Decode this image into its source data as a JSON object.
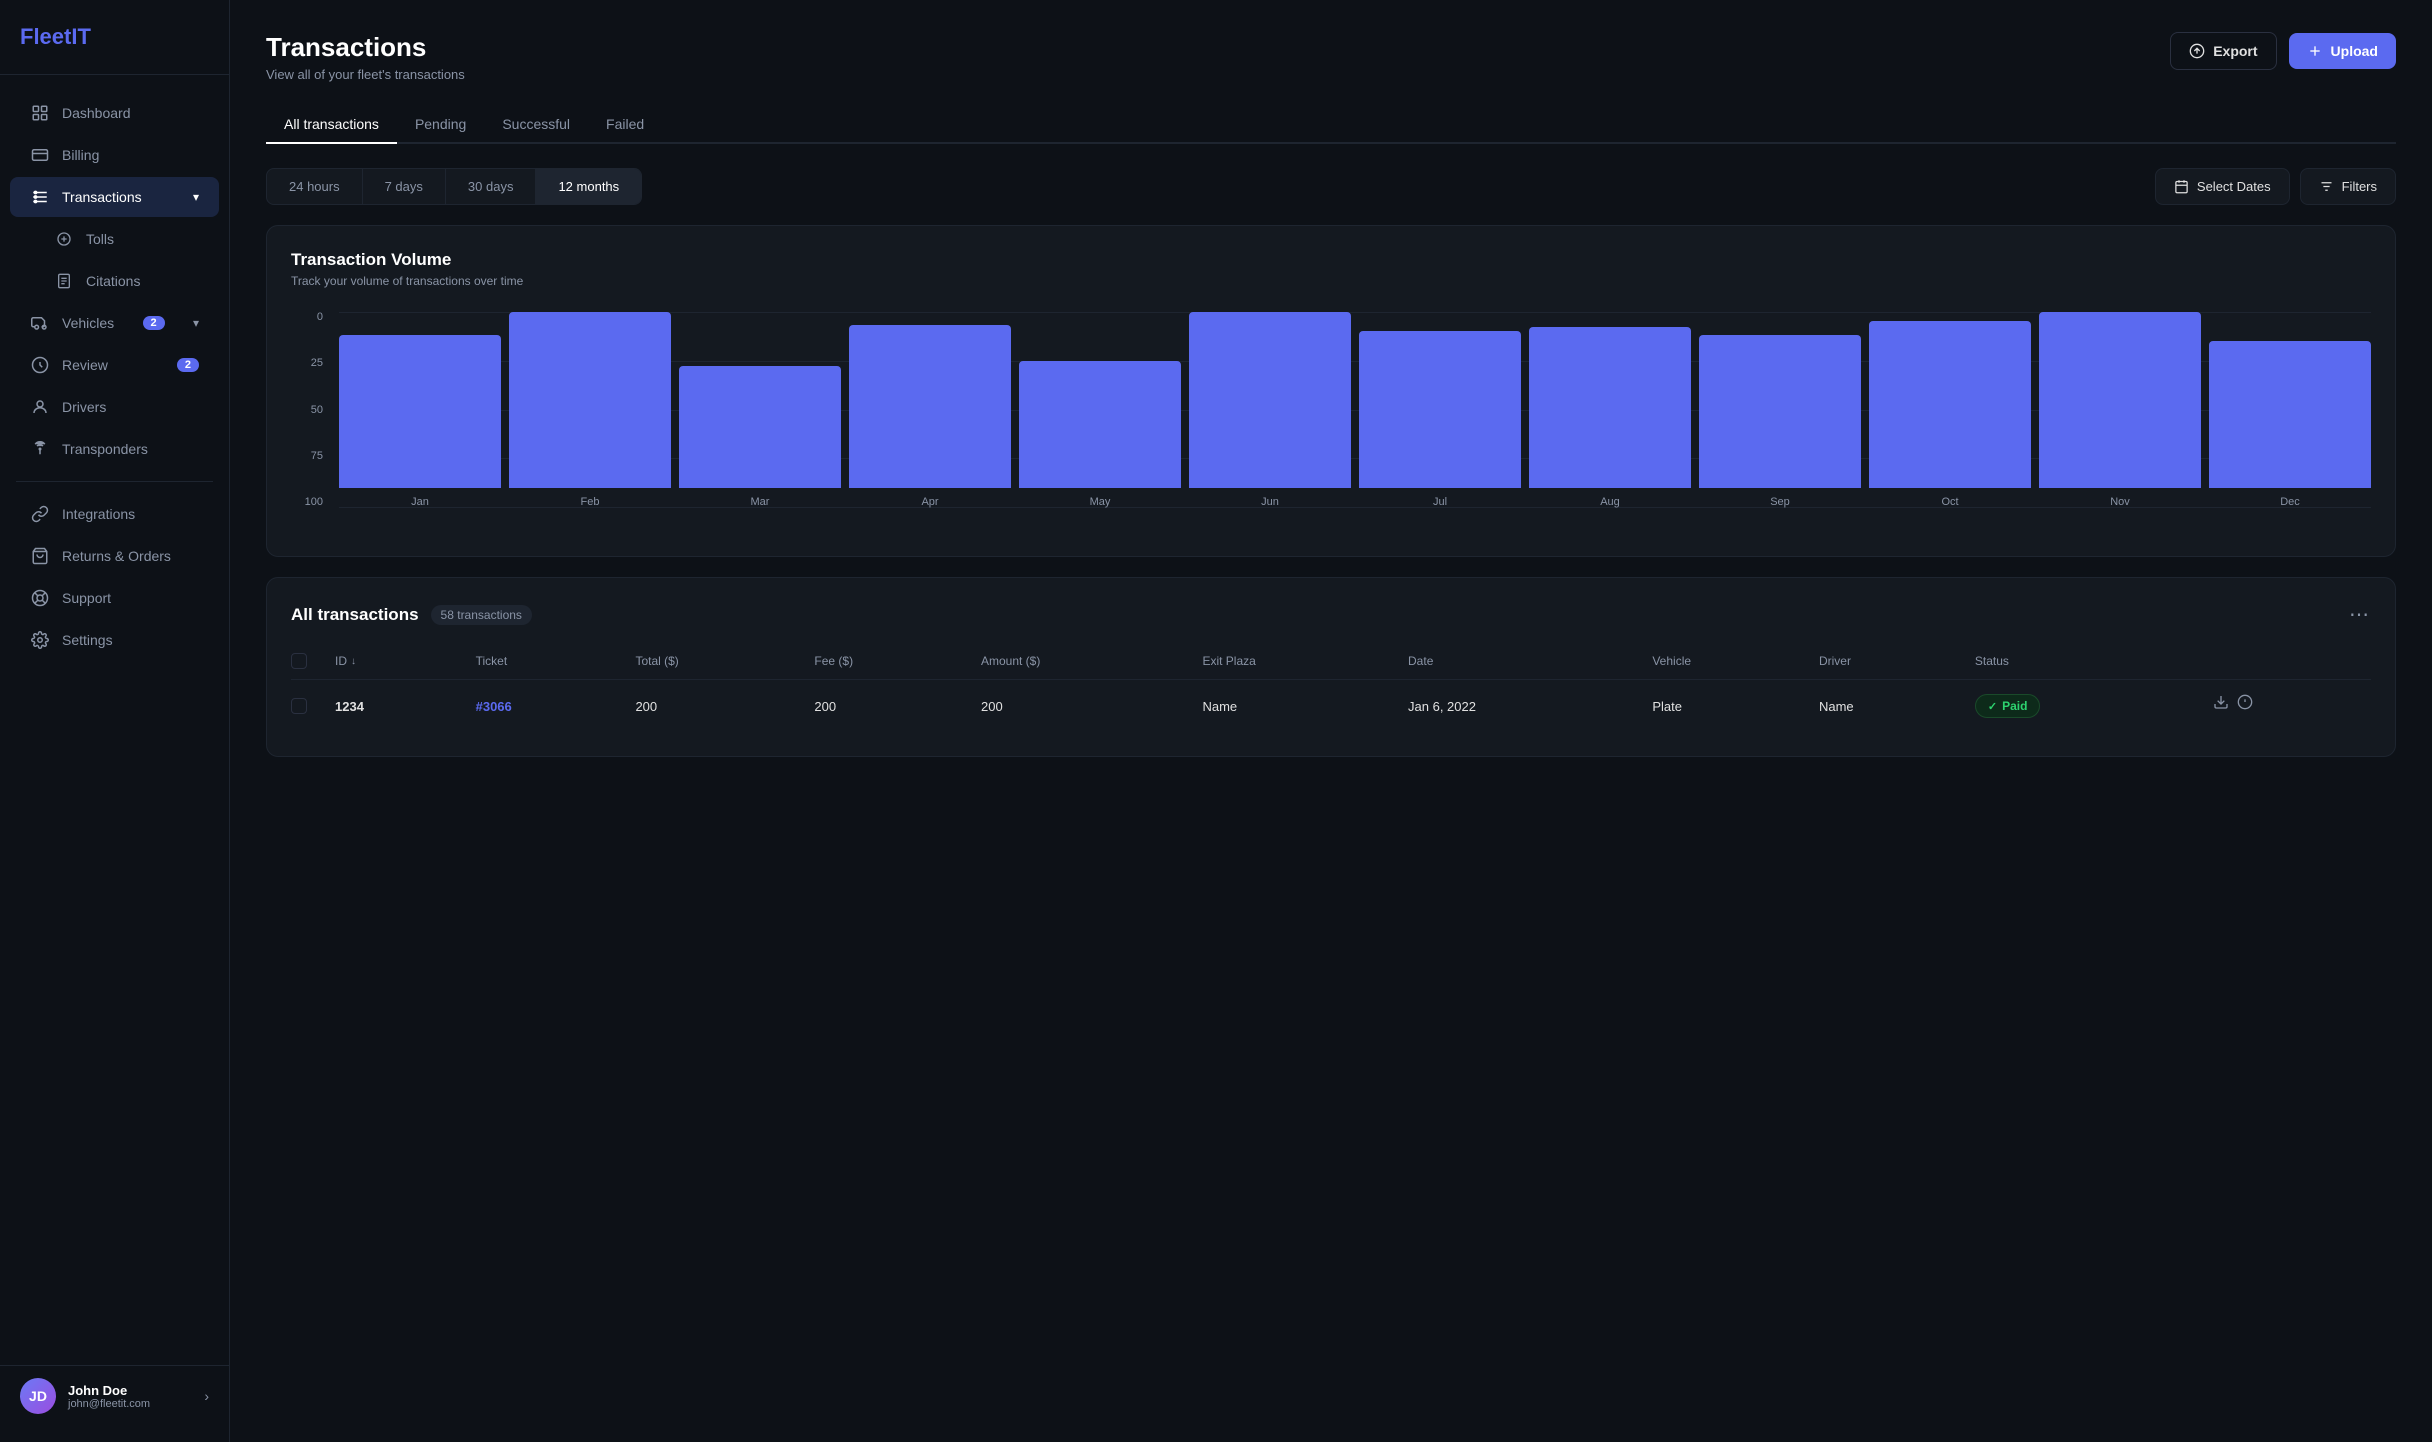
{
  "brand": {
    "name_start": "Fleet",
    "name_end": "IT"
  },
  "sidebar": {
    "items": [
      {
        "id": "dashboard",
        "label": "Dashboard",
        "icon": "dashboard",
        "active": false,
        "badge": null
      },
      {
        "id": "billing",
        "label": "Billing",
        "icon": "billing",
        "active": false,
        "badge": null
      },
      {
        "id": "transactions",
        "label": "Transactions",
        "icon": "transactions",
        "active": true,
        "badge": null,
        "hasChevron": true
      },
      {
        "id": "tolls",
        "label": "Tolls",
        "icon": "tolls",
        "active": false,
        "badge": null,
        "indent": true
      },
      {
        "id": "citations",
        "label": "Citations",
        "icon": "citations",
        "active": false,
        "badge": null,
        "indent": true
      },
      {
        "id": "vehicles",
        "label": "Vehicles",
        "icon": "vehicles",
        "active": false,
        "badge": "2",
        "hasChevron": true
      },
      {
        "id": "review",
        "label": "Review",
        "icon": "review",
        "active": false,
        "badge": "2"
      },
      {
        "id": "drivers",
        "label": "Drivers",
        "icon": "drivers",
        "active": false,
        "badge": null
      },
      {
        "id": "transponders",
        "label": "Transponders",
        "icon": "transponders",
        "active": false,
        "badge": null
      }
    ],
    "items2": [
      {
        "id": "integrations",
        "label": "Integrations",
        "icon": "integrations"
      },
      {
        "id": "returns",
        "label": "Returns & Orders",
        "icon": "returns"
      },
      {
        "id": "support",
        "label": "Support",
        "icon": "support"
      },
      {
        "id": "settings",
        "label": "Settings",
        "icon": "settings"
      }
    ],
    "user": {
      "name": "John Doe",
      "email": "john@fleetit.com",
      "initials": "JD"
    }
  },
  "page": {
    "title": "Transactions",
    "subtitle": "View all of your fleet's transactions",
    "export_label": "Export",
    "upload_label": "Upload"
  },
  "tabs": [
    {
      "id": "all",
      "label": "All transactions",
      "active": true
    },
    {
      "id": "pending",
      "label": "Pending",
      "active": false
    },
    {
      "id": "successful",
      "label": "Successful",
      "active": false
    },
    {
      "id": "failed",
      "label": "Failed",
      "active": false
    }
  ],
  "date_filters": [
    {
      "id": "24h",
      "label": "24 hours",
      "active": false
    },
    {
      "id": "7d",
      "label": "7 days",
      "active": false
    },
    {
      "id": "30d",
      "label": "30 days",
      "active": false
    },
    {
      "id": "12m",
      "label": "12 months",
      "active": true
    }
  ],
  "select_dates_label": "Select Dates",
  "filters_label": "Filters",
  "chart": {
    "title": "Transaction Volume",
    "subtitle": "Track your volume of transactions over time",
    "y_labels": [
      "100",
      "75",
      "50",
      "25",
      "0"
    ],
    "bars": [
      {
        "month": "Jan",
        "value": 78
      },
      {
        "month": "Feb",
        "value": 100
      },
      {
        "month": "Mar",
        "value": 62
      },
      {
        "month": "Apr",
        "value": 83
      },
      {
        "month": "May",
        "value": 65
      },
      {
        "month": "Jun",
        "value": 90
      },
      {
        "month": "Jul",
        "value": 80
      },
      {
        "month": "Aug",
        "value": 82
      },
      {
        "month": "Sep",
        "value": 78
      },
      {
        "month": "Oct",
        "value": 85
      },
      {
        "month": "Nov",
        "value": 97
      },
      {
        "month": "Dec",
        "value": 75
      }
    ],
    "max_value": 100
  },
  "transactions_table": {
    "title": "All transactions",
    "count_label": "58 transactions",
    "columns": [
      {
        "id": "id",
        "label": "ID",
        "sortable": true
      },
      {
        "id": "ticket",
        "label": "Ticket"
      },
      {
        "id": "total",
        "label": "Total ($)"
      },
      {
        "id": "fee",
        "label": "Fee ($)"
      },
      {
        "id": "amount",
        "label": "Amount ($)"
      },
      {
        "id": "exit_plaza",
        "label": "Exit Plaza"
      },
      {
        "id": "date",
        "label": "Date"
      },
      {
        "id": "vehicle",
        "label": "Vehicle"
      },
      {
        "id": "driver",
        "label": "Driver"
      },
      {
        "id": "status",
        "label": "Status"
      }
    ],
    "rows": [
      {
        "id": "1234",
        "ticket": "#3066",
        "total": "200",
        "fee": "200",
        "amount": "200",
        "exit_plaza": "Name",
        "date": "Jan 6, 2022",
        "vehicle": "Plate",
        "driver": "Name",
        "status": "Paid"
      }
    ]
  }
}
